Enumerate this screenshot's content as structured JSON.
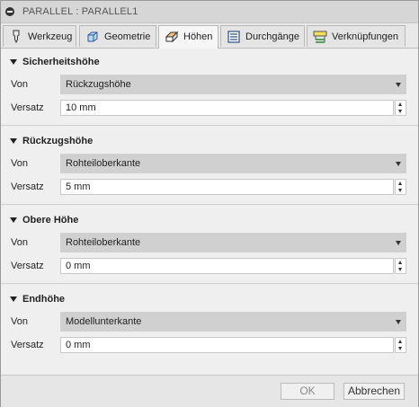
{
  "window": {
    "title": "PARALLEL : PARALLEL1"
  },
  "tabs": [
    {
      "label": "Werkzeug",
      "icon": "tool-icon",
      "active": false
    },
    {
      "label": "Geometrie",
      "icon": "geometry-icon",
      "active": false
    },
    {
      "label": "Höhen",
      "icon": "heights-icon",
      "active": true
    },
    {
      "label": "Durchgänge",
      "icon": "passes-icon",
      "active": false
    },
    {
      "label": "Verknüpfungen",
      "icon": "linking-icon",
      "active": false
    }
  ],
  "sections": [
    {
      "title": "Sicherheitshöhe",
      "from_label": "Von",
      "from_value": "Rückzugshöhe",
      "offset_label": "Versatz",
      "offset_value": "10 mm"
    },
    {
      "title": "Rückzugshöhe",
      "from_label": "Von",
      "from_value": "Rohteiloberkante",
      "offset_label": "Versatz",
      "offset_value": "5 mm"
    },
    {
      "title": "Obere Höhe",
      "from_label": "Von",
      "from_value": "Rohteiloberkante",
      "offset_label": "Versatz",
      "offset_value": "0 mm"
    },
    {
      "title": "Endhöhe",
      "from_label": "Von",
      "from_value": "Modellunterkante",
      "offset_label": "Versatz",
      "offset_value": "0 mm"
    }
  ],
  "footer": {
    "ok_label": "OK",
    "cancel_label": "Abbrechen"
  }
}
